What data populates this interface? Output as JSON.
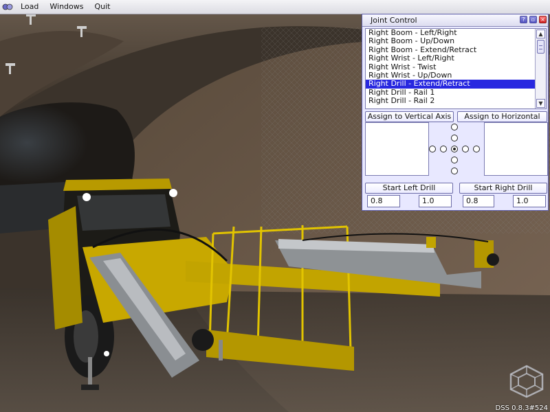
{
  "menubar": {
    "items": [
      "Load",
      "Windows",
      "Quit"
    ]
  },
  "joint_control": {
    "title": "Joint Control",
    "title_buttons": {
      "help": "?",
      "minimize": "▫",
      "close": "×"
    },
    "joints": [
      "Right Boom - Left/Right",
      "Right Boom - Up/Down",
      "Right Boom - Extend/Retract",
      "Right Wrist - Left/Right",
      "Right Wrist - Twist",
      "Right Wrist - Up/Down",
      "Right Drill - Extend/Retract",
      "Right Drill - Rail 1",
      "Right Drill - Rail 2"
    ],
    "selected_index": 6,
    "assign_vertical_label": "Assign to Vertical Axis",
    "assign_horizontal_label": "Assign to Horizontal Axis",
    "start_left_drill_label": "Start Left Drill",
    "start_right_drill_label": "Start Right Drill",
    "left_drill_values": [
      "0.8",
      "1.0"
    ],
    "right_drill_values": [
      "0.8",
      "1.0"
    ]
  },
  "status": {
    "version": "DSS 0.8.3#524"
  },
  "colors": {
    "window_bg": "#e8e8ff",
    "selection": "#2828e0",
    "machine_yellow": "#c8a800",
    "rock": "#4a3e32"
  },
  "icons": {
    "menu_logo": "app-logo-icon",
    "corner_logo": "hexagon-logo-icon"
  }
}
